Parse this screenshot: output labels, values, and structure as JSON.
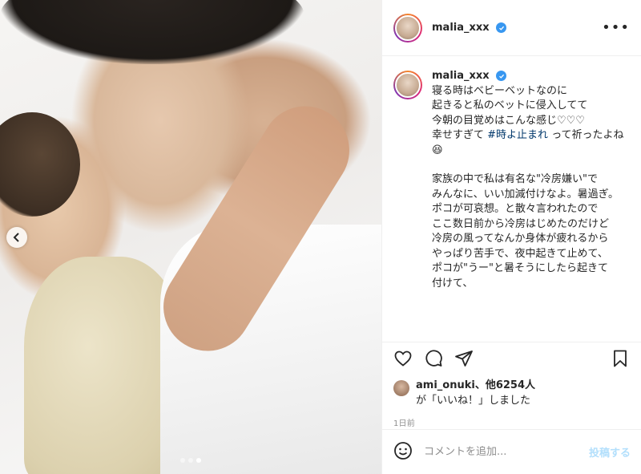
{
  "post": {
    "username": "malia_xxx",
    "more_label": "•••",
    "caption_lines": [
      "寝る時はベビーベットなのに",
      "起きると私のベットに侵入してて",
      "今朝の目覚めはこんな感じ♡♡♡",
      "幸せすぎて"
    ],
    "hashtag": "#時よ止まれ",
    "caption_after_hashtag": " って祈ったよね😆",
    "caption_block2": [
      "家族の中で私は有名な\"冷房嫌い\"で",
      "みんなに、いい加減付けなよ。暑過ぎ。",
      "ポコが可哀想。と散々言われたので",
      "ここ数日前から冷房はじめたのだけど",
      "冷房の風ってなんか身体が疲れるから",
      "やっぱり苦手で、夜中起きて止めて、",
      "ポコが\"うー\"と暑そうにしたら起きて",
      "付けて、"
    ],
    "likes_user": "ami_onuki",
    "likes_others": "、他6254人",
    "likes_suffix": "が「いいね！」しました",
    "timestamp": "1日前",
    "comment_placeholder": "コメントを追加...",
    "post_button": "投稿する"
  },
  "carousel": {
    "slide_count": 3,
    "active_index": 2
  },
  "icons": {
    "like": "heart-icon",
    "comment": "comment-icon",
    "share": "send-icon",
    "save": "bookmark-icon",
    "emoji": "emoji-icon",
    "verified": "verified-icon",
    "prev": "chevron-left-icon"
  },
  "colors": {
    "verified": "#3897f0",
    "hashtag": "#00376b",
    "post_button": "#b2dffc"
  }
}
